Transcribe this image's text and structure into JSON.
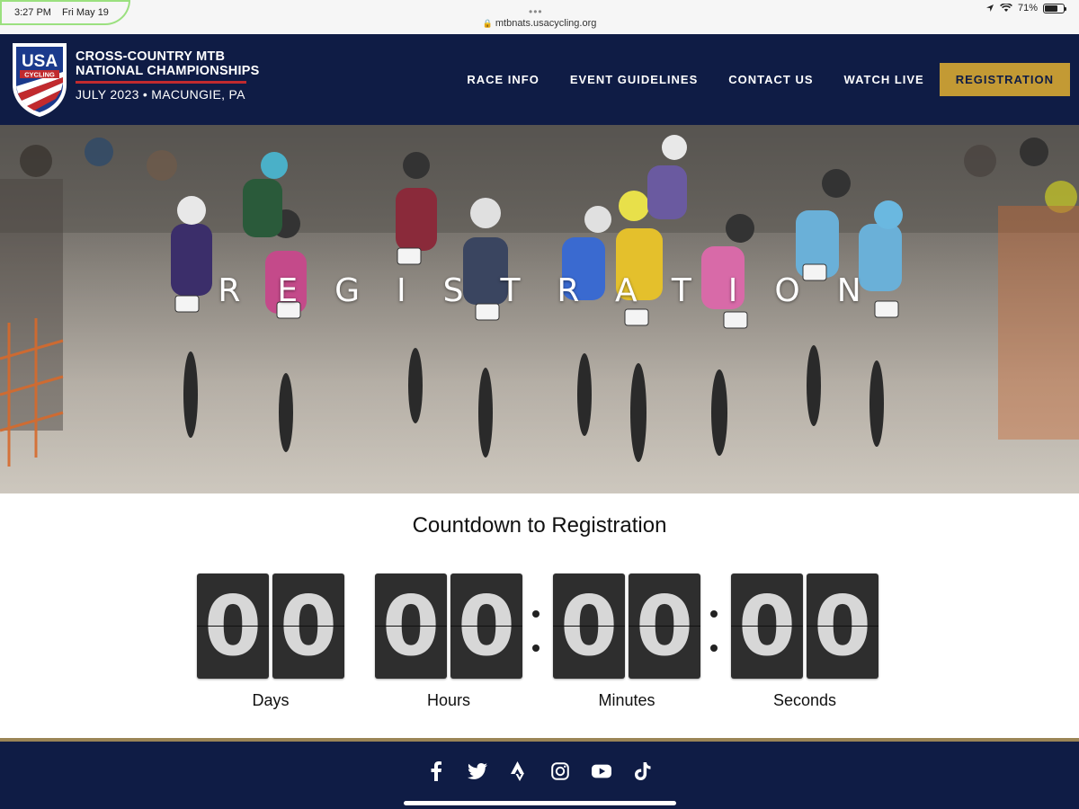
{
  "status_bar": {
    "time": "3:27 PM",
    "date": "Fri May 19",
    "url": "mtbnats.usacycling.org",
    "battery": "71%",
    "battery_level": 0.71
  },
  "header": {
    "logo_text_top": "USA",
    "logo_text_bottom": "CYCLING",
    "brand_line1": "CROSS-COUNTRY MTB",
    "brand_line2": "NATIONAL CHAMPIONSHIPS",
    "brand_date": "JULY 2023 • MACUNGIE, PA",
    "nav": [
      "RACE INFO",
      "EVENT GUIDELINES",
      "CONTACT US",
      "WATCH LIVE"
    ],
    "cta": "REGISTRATION"
  },
  "hero": {
    "title": "REGISTRATION"
  },
  "countdown": {
    "title": "Countdown to Registration",
    "units": [
      {
        "label": "Days",
        "digits": [
          "0",
          "0"
        ]
      },
      {
        "label": "Hours",
        "digits": [
          "0",
          "0"
        ]
      },
      {
        "label": "Minutes",
        "digits": [
          "0",
          "0"
        ]
      },
      {
        "label": "Seconds",
        "digits": [
          "0",
          "0"
        ]
      }
    ]
  },
  "footer": {
    "social": [
      "facebook-icon",
      "twitter-icon",
      "strava-icon",
      "instagram-icon",
      "youtube-icon",
      "tiktok-icon"
    ]
  },
  "colors": {
    "navy": "#0f1c45",
    "gold": "#c39a34",
    "red": "#c12a2e"
  }
}
